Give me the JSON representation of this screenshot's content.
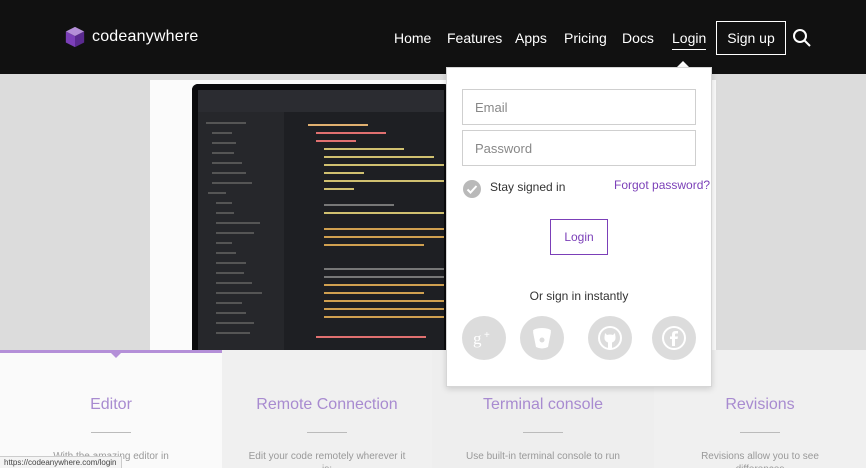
{
  "nav": {
    "brand": "codeanywhere",
    "links": [
      {
        "label": "Home"
      },
      {
        "label": "Features"
      },
      {
        "label": "Apps"
      },
      {
        "label": "Pricing"
      },
      {
        "label": "Docs"
      },
      {
        "label": "Login"
      }
    ],
    "signup_label": "Sign up"
  },
  "login": {
    "email_placeholder": "Email",
    "password_placeholder": "Password",
    "stay_signed_in": "Stay signed in",
    "forgot_password": "Forgot password?",
    "login_button": "Login",
    "or_sign_in": "Or sign in instantly",
    "social": [
      "google-plus-icon",
      "bitbucket-icon",
      "github-icon",
      "facebook-icon"
    ]
  },
  "features": [
    {
      "title": "Editor",
      "desc": "With the amazing editor in"
    },
    {
      "title": "Remote Connection",
      "desc": "Edit your code remotely wherever it is;"
    },
    {
      "title": "Terminal console",
      "desc": "Use built-in terminal console to run"
    },
    {
      "title": "Revisions",
      "desc": "Revisions allow you to see differences"
    }
  ],
  "status_url": "https://codeanywhere.com/login",
  "colors": {
    "accent": "#7b3fb8",
    "feature_title": "#a88bd0",
    "nav_bg": "#111111"
  }
}
